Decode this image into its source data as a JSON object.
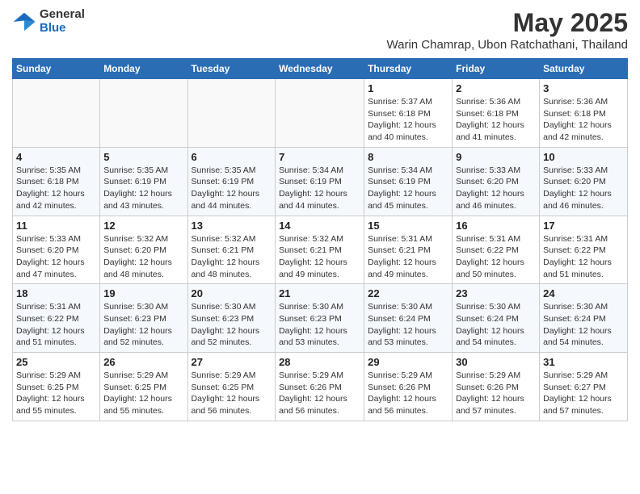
{
  "logo": {
    "general": "General",
    "blue": "Blue"
  },
  "title": "May 2025",
  "subtitle": "Warin Chamrap, Ubon Ratchathani, Thailand",
  "days_header": [
    "Sunday",
    "Monday",
    "Tuesday",
    "Wednesday",
    "Thursday",
    "Friday",
    "Saturday"
  ],
  "weeks": [
    [
      {
        "day": "",
        "detail": ""
      },
      {
        "day": "",
        "detail": ""
      },
      {
        "day": "",
        "detail": ""
      },
      {
        "day": "",
        "detail": ""
      },
      {
        "day": "1",
        "detail": "Sunrise: 5:37 AM\nSunset: 6:18 PM\nDaylight: 12 hours\nand 40 minutes."
      },
      {
        "day": "2",
        "detail": "Sunrise: 5:36 AM\nSunset: 6:18 PM\nDaylight: 12 hours\nand 41 minutes."
      },
      {
        "day": "3",
        "detail": "Sunrise: 5:36 AM\nSunset: 6:18 PM\nDaylight: 12 hours\nand 42 minutes."
      }
    ],
    [
      {
        "day": "4",
        "detail": "Sunrise: 5:35 AM\nSunset: 6:18 PM\nDaylight: 12 hours\nand 42 minutes."
      },
      {
        "day": "5",
        "detail": "Sunrise: 5:35 AM\nSunset: 6:19 PM\nDaylight: 12 hours\nand 43 minutes."
      },
      {
        "day": "6",
        "detail": "Sunrise: 5:35 AM\nSunset: 6:19 PM\nDaylight: 12 hours\nand 44 minutes."
      },
      {
        "day": "7",
        "detail": "Sunrise: 5:34 AM\nSunset: 6:19 PM\nDaylight: 12 hours\nand 44 minutes."
      },
      {
        "day": "8",
        "detail": "Sunrise: 5:34 AM\nSunset: 6:19 PM\nDaylight: 12 hours\nand 45 minutes."
      },
      {
        "day": "9",
        "detail": "Sunrise: 5:33 AM\nSunset: 6:20 PM\nDaylight: 12 hours\nand 46 minutes."
      },
      {
        "day": "10",
        "detail": "Sunrise: 5:33 AM\nSunset: 6:20 PM\nDaylight: 12 hours\nand 46 minutes."
      }
    ],
    [
      {
        "day": "11",
        "detail": "Sunrise: 5:33 AM\nSunset: 6:20 PM\nDaylight: 12 hours\nand 47 minutes."
      },
      {
        "day": "12",
        "detail": "Sunrise: 5:32 AM\nSunset: 6:20 PM\nDaylight: 12 hours\nand 48 minutes."
      },
      {
        "day": "13",
        "detail": "Sunrise: 5:32 AM\nSunset: 6:21 PM\nDaylight: 12 hours\nand 48 minutes."
      },
      {
        "day": "14",
        "detail": "Sunrise: 5:32 AM\nSunset: 6:21 PM\nDaylight: 12 hours\nand 49 minutes."
      },
      {
        "day": "15",
        "detail": "Sunrise: 5:31 AM\nSunset: 6:21 PM\nDaylight: 12 hours\nand 49 minutes."
      },
      {
        "day": "16",
        "detail": "Sunrise: 5:31 AM\nSunset: 6:22 PM\nDaylight: 12 hours\nand 50 minutes."
      },
      {
        "day": "17",
        "detail": "Sunrise: 5:31 AM\nSunset: 6:22 PM\nDaylight: 12 hours\nand 51 minutes."
      }
    ],
    [
      {
        "day": "18",
        "detail": "Sunrise: 5:31 AM\nSunset: 6:22 PM\nDaylight: 12 hours\nand 51 minutes."
      },
      {
        "day": "19",
        "detail": "Sunrise: 5:30 AM\nSunset: 6:23 PM\nDaylight: 12 hours\nand 52 minutes."
      },
      {
        "day": "20",
        "detail": "Sunrise: 5:30 AM\nSunset: 6:23 PM\nDaylight: 12 hours\nand 52 minutes."
      },
      {
        "day": "21",
        "detail": "Sunrise: 5:30 AM\nSunset: 6:23 PM\nDaylight: 12 hours\nand 53 minutes."
      },
      {
        "day": "22",
        "detail": "Sunrise: 5:30 AM\nSunset: 6:24 PM\nDaylight: 12 hours\nand 53 minutes."
      },
      {
        "day": "23",
        "detail": "Sunrise: 5:30 AM\nSunset: 6:24 PM\nDaylight: 12 hours\nand 54 minutes."
      },
      {
        "day": "24",
        "detail": "Sunrise: 5:30 AM\nSunset: 6:24 PM\nDaylight: 12 hours\nand 54 minutes."
      }
    ],
    [
      {
        "day": "25",
        "detail": "Sunrise: 5:29 AM\nSunset: 6:25 PM\nDaylight: 12 hours\nand 55 minutes."
      },
      {
        "day": "26",
        "detail": "Sunrise: 5:29 AM\nSunset: 6:25 PM\nDaylight: 12 hours\nand 55 minutes."
      },
      {
        "day": "27",
        "detail": "Sunrise: 5:29 AM\nSunset: 6:25 PM\nDaylight: 12 hours\nand 56 minutes."
      },
      {
        "day": "28",
        "detail": "Sunrise: 5:29 AM\nSunset: 6:26 PM\nDaylight: 12 hours\nand 56 minutes."
      },
      {
        "day": "29",
        "detail": "Sunrise: 5:29 AM\nSunset: 6:26 PM\nDaylight: 12 hours\nand 56 minutes."
      },
      {
        "day": "30",
        "detail": "Sunrise: 5:29 AM\nSunset: 6:26 PM\nDaylight: 12 hours\nand 57 minutes."
      },
      {
        "day": "31",
        "detail": "Sunrise: 5:29 AM\nSunset: 6:27 PM\nDaylight: 12 hours\nand 57 minutes."
      }
    ]
  ]
}
